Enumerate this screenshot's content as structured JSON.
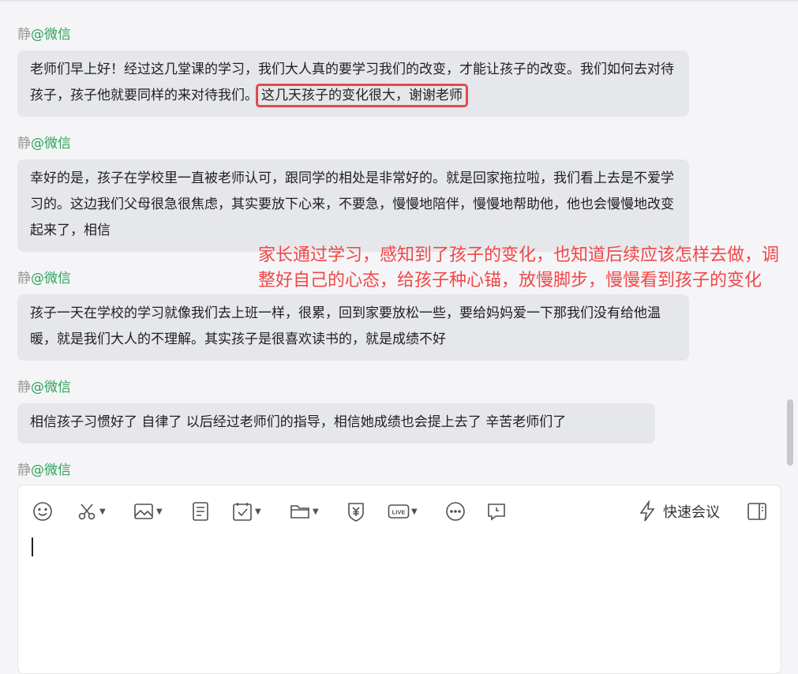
{
  "messages": [
    {
      "sender": "静",
      "source": "@微信",
      "text": "老师们早上好！经过这几堂课的学习，我们大人真的要学习我们的改变，才能让孩子的改变。我们如何去对待孩子，孩子他就要同样的来对待我们。",
      "highlight": "这几天孩子的变化很大，谢谢老师"
    },
    {
      "sender": "静",
      "source": "@微信",
      "text": "幸好的是，孩子在学校里一直被老师认可，跟同学的相处是非常好的。就是回家拖拉啦，我们看上去是不爱学习的。这边我们父母很急很焦虑，其实要放下心来，不要急，慢慢地陪伴，慢慢地帮助他，他也会慢慢地改变起来了，相信"
    },
    {
      "sender": "静",
      "source": "@微信",
      "text": "孩子一天在学校的学习就像我们去上班一样，很累，回到家要放松一些，要给妈妈爱一下那我们没有给他温暖，就是我们大人的不理解。其实孩子是很喜欢读书的，就是成绩不好"
    },
    {
      "sender": "静",
      "source": "@微信",
      "text": "相信孩子习惯好了 自律了 以后经过老师们的指导，相信她成绩也会提上去了 辛苦老师们了"
    },
    {
      "sender": "静",
      "source": "@微信"
    }
  ],
  "annotation": "家长通过学习，感知到了孩子的变化，也知道后续应该怎样去做，调整好自己的心态，给孩子种心锚，放慢脚步，慢慢看到孩子的变化",
  "toolbar": {
    "quick_meeting_label": "快速会议",
    "icons": [
      "emoji-icon",
      "scissors-icon",
      "image-icon",
      "document-icon",
      "calendar-check-icon",
      "folder-icon",
      "yen-shield-icon",
      "live-icon",
      "more-icon",
      "chat-clock-icon",
      "lightning-icon",
      "sidebar-toggle-icon"
    ]
  },
  "colors": {
    "source_green": "#2ea35a",
    "highlight_red": "#e5484d",
    "annotation_red": "#f04747",
    "bubble_bg": "#e6e7ea"
  }
}
